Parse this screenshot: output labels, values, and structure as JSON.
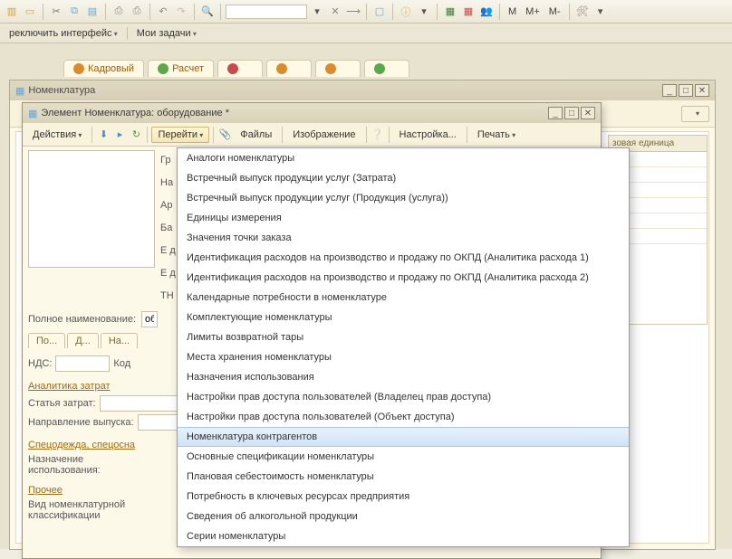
{
  "main_toolbar": {
    "text_buttons": [
      "M",
      "M+",
      "M-"
    ]
  },
  "menu_bar": {
    "items": [
      "реключить интерфейс",
      "Мои задачи"
    ]
  },
  "top_tabs": [
    {
      "label": "Кадровый",
      "color": "#d98c2e"
    },
    {
      "label": "Расчет",
      "color": "#5aa84c"
    },
    {
      "label": "",
      "color": "#c74b4b"
    },
    {
      "label": "",
      "color": "#d98c2e"
    },
    {
      "label": "",
      "color": "#d98c2e"
    },
    {
      "label": "",
      "color": "#5aa84c"
    }
  ],
  "win1": {
    "title": "Номенклатура",
    "right_col_header": "зовая единица"
  },
  "win2": {
    "title": "Элемент Номенклатура: оборудование *",
    "toolbar": {
      "actions": "Действия",
      "goto": "Перейти",
      "files": "Файлы",
      "image": "Изображение",
      "settings": "Настройка...",
      "print": "Печать"
    },
    "form": {
      "gr": "Гр",
      "na1": "На",
      "ar": "Ар",
      "ba": "Ба",
      "ed1": "Е д",
      "ed2": "Е д",
      "th": "ТН",
      "full_name_label": "Полное наименование:",
      "full_name_value": "об",
      "mini_tabs": [
        "По...",
        "Д...",
        "На..."
      ],
      "nds_label": "НДС:",
      "kod_label": "Код",
      "sec_analytics": "Аналитика затрат",
      "cost_item": "Статья затрат:",
      "output_dir": "Направление выпуска:",
      "sec_spec": "Спецодежда, спецосна",
      "assign_use1": "Назначение",
      "assign_use2": "использования:",
      "sec_other": "Прочее",
      "nomencl_type1": "Вид номенклатурной",
      "nomencl_type2": "классификации"
    }
  },
  "dropdown": {
    "items": [
      "Аналоги номенклатуры",
      "Встречный выпуск продукции услуг (Затрата)",
      "Встречный выпуск продукции услуг (Продукция (услуга))",
      "Единицы измерения",
      "Значения точки заказа",
      "Идентификация расходов на производство и продажу по ОКПД (Аналитика расхода 1)",
      "Идентификация расходов на производство и продажу по ОКПД (Аналитика расхода 2)",
      "Календарные потребности в номенклатуре",
      "Комплектующие номенклатуры",
      "Лимиты возвратной тары",
      "Места хранения номенклатуры",
      "Назначения использования",
      "Настройки прав доступа пользователей (Владелец прав доступа)",
      "Настройки прав доступа пользователей (Объект доступа)",
      "Номенклатура контрагентов",
      "Основные спецификации номенклатуры",
      "Плановая себестоимость номенклатуры",
      "Потребность в ключевых ресурсах предприятия",
      "Сведения об алкогольной продукции",
      "Серии номенклатуры"
    ],
    "highlight_index": 14
  }
}
